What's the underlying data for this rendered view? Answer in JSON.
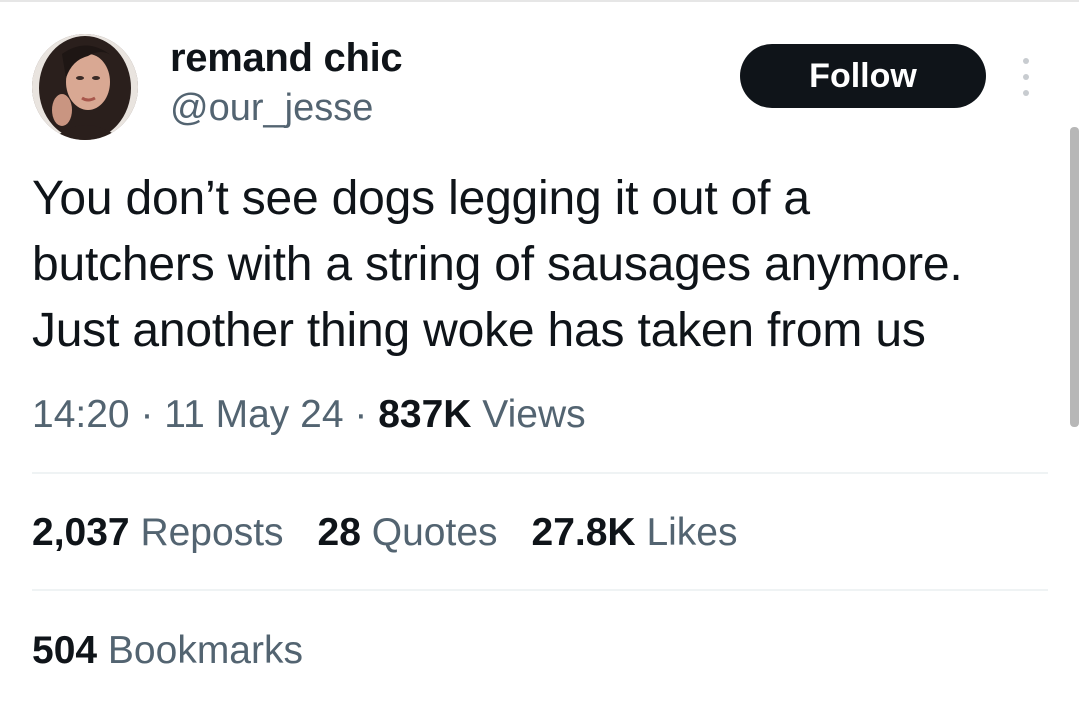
{
  "author": {
    "display_name": "remand chic",
    "handle": "@our_jesse",
    "avatar_icon": "profile-photo"
  },
  "follow_button": {
    "label": "Follow"
  },
  "more_menu_icon": "more-vertical-icon",
  "tweet": {
    "lines": [
      "You don’t see dogs legging it out of a",
      "butchers with a string of sausages anymore.",
      "Just another thing woke has taken from us"
    ]
  },
  "meta": {
    "time": "14:20",
    "separator": "·",
    "date": "11 May 24",
    "views_count": "837K",
    "views_label": "Views"
  },
  "stats": {
    "reposts_count": "2,037",
    "reposts_label": "Reposts",
    "quotes_count": "28",
    "quotes_label": "Quotes",
    "likes_count": "27.8K",
    "likes_label": "Likes"
  },
  "bookmarks": {
    "count": "504",
    "label": "Bookmarks"
  },
  "colors": {
    "text_primary": "#0f1419",
    "text_secondary": "#536471",
    "button_bg": "#0f1419",
    "divider": "#eff3f4"
  }
}
